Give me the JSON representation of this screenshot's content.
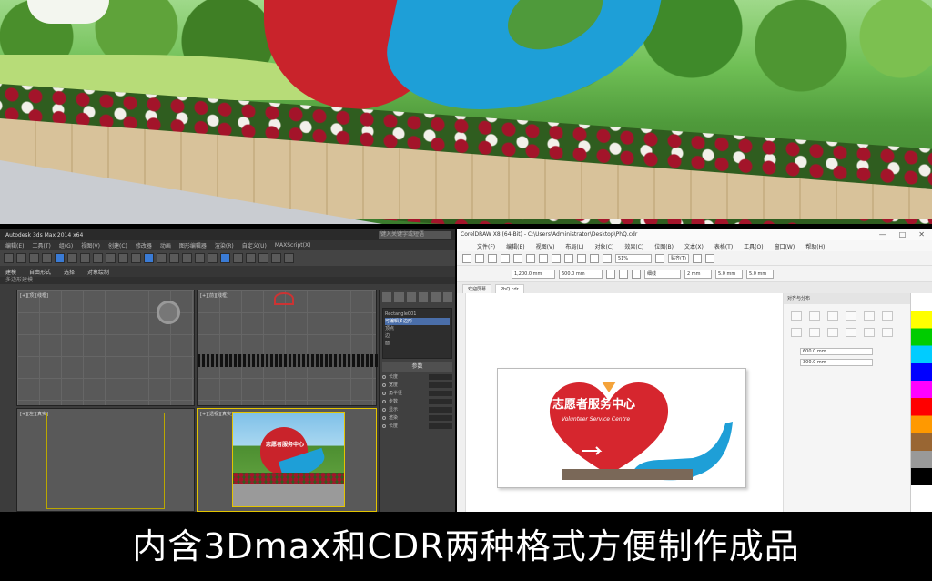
{
  "max_window": {
    "title": "Autodesk 3ds Max 2014 x64",
    "search_placeholder": "键入关键字或短语",
    "menu": [
      "编辑(E)",
      "工具(T)",
      "组(G)",
      "视图(V)",
      "创建(C)",
      "修改器",
      "动画",
      "图形编辑器",
      "渲染(R)",
      "自定义(U)",
      "MAXScript(X)"
    ],
    "ribbon_tabs": [
      "建模",
      "自由形式",
      "选择",
      "对象绘制"
    ],
    "sub_label": "多边形建模",
    "viewports": {
      "top": "[+][顶][线框]",
      "front": "[+][前][线框]",
      "left": "[+][左][真实]",
      "perspective": "[+][透视][真实]"
    },
    "command_panel": {
      "list_items": [
        "Rectangle001",
        "可编辑多边形",
        "顶点",
        "边",
        "面"
      ],
      "selected_index": 1,
      "section_title": "参数",
      "options": [
        "长度",
        "宽度",
        "角半径",
        "步数",
        "显示",
        "渲染",
        "长度"
      ]
    }
  },
  "cdr_window": {
    "title": "CorelDRAW X8 (64-Bit) - C:\\Users\\Administrator\\Desktop\\PhQ.cdr",
    "window_controls": [
      "—",
      "□",
      "✕"
    ],
    "menu": [
      "文件(F)",
      "编辑(E)",
      "视图(V)",
      "布局(L)",
      "对象(C)",
      "效果(C)",
      "位图(B)",
      "文本(X)",
      "表格(T)",
      "工具(O)",
      "窗口(W)",
      "帮助(H)"
    ],
    "zoom": "51%",
    "snap_label": "贴齐(T)",
    "x_field": "1,200.0 mm",
    "y_field": "600.0 mm",
    "outline_width": "细线",
    "nudge": "2 mm",
    "dup1": "5.0 mm",
    "dup2": "5.0 mm",
    "tabs": [
      "欢迎屏幕",
      "PhQ.cdr"
    ],
    "active_tab": 1,
    "docker_title": "对齐与分布",
    "docker_fields": [
      "600.0 mm",
      "300.0 mm"
    ],
    "sign": {
      "title": "志愿者服务中心",
      "subtitle": "Volunteer Service Centre"
    }
  },
  "colors": {
    "heart_red": "#d6262e",
    "hand_blue": "#1e9fd7",
    "base_brown": "#7a6858"
  },
  "caption": "内含3Dmax和CDR两种格式方便制作成品"
}
